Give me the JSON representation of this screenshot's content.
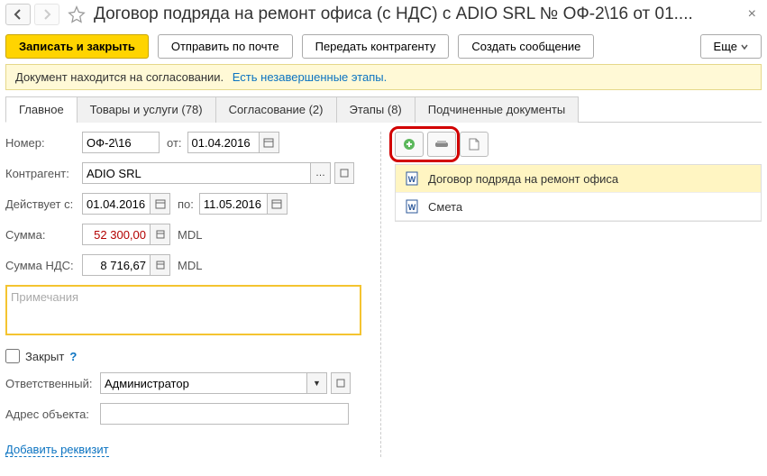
{
  "title": "Договор подряда на ремонт офиса (с НДС) с ADIO SRL № ОФ-2\\16 от 01....",
  "toolbar": {
    "save": "Записать и закрыть",
    "send_mail": "Отправить по почте",
    "send_counterparty": "Передать контрагенту",
    "create_msg": "Создать сообщение",
    "more": "Еще"
  },
  "banner": {
    "text": "Документ находится на согласовании.",
    "hint": "Есть незавершенные этапы."
  },
  "tabs": {
    "main": "Главное",
    "goods": "Товары и услуги (78)",
    "approval": "Согласование (2)",
    "stages": "Этапы (8)",
    "subdocs": "Подчиненные документы"
  },
  "form": {
    "number_lbl": "Номер:",
    "number": "ОФ-2\\16",
    "from_lbl": "от:",
    "from": "01.04.2016",
    "counterparty_lbl": "Контрагент:",
    "counterparty": "ADIO SRL",
    "valid_from_lbl": "Действует с:",
    "valid_from": "01.04.2016",
    "to_lbl": "по:",
    "to": "11.05.2016",
    "sum_lbl": "Сумма:",
    "sum": "52 300,00",
    "currency": "MDL",
    "vat_lbl": "Сумма НДС:",
    "vat": "8 716,67",
    "notes_ph": "Примечания",
    "closed_lbl": "Закрыт",
    "help": "?",
    "resp_lbl": "Ответственный:",
    "resp": "Администратор",
    "addr_lbl": "Адрес объекта:",
    "add_link": "Добавить реквизит"
  },
  "files": {
    "item1": "Договор подряда на ремонт офиса",
    "item2": "Смета"
  }
}
